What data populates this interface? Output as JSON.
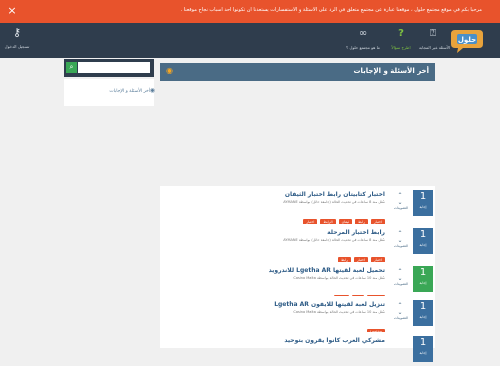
{
  "notice": {
    "text": "مرحبا بكم في موقع مجتمع حلول ، موقعنا عبارة عن مجتمع متعلق في الرد على الاسئلة و الاستفسارات يستعدنا ان تكونوا احد اسباب نجاح موقعنا .",
    "close": "×"
  },
  "header": {
    "login_label": "تسجيل الدخول",
    "login_icon": "key-icon",
    "logo_text": "حلول",
    "nav": [
      {
        "label": "الأسئلة غير المجابة",
        "icon": "question-circle-icon",
        "glyph": "⍰"
      },
      {
        "label": "اطرح سؤالاً",
        "icon": "question-mark-icon",
        "glyph": "?"
      },
      {
        "label": "ما هو مجتمع حلول ؟",
        "icon": "infinity-icon",
        "glyph": "∞"
      }
    ]
  },
  "sidebar": {
    "search_placeholder": "",
    "feed_label": "أخر الأسئلة و الإجابات"
  },
  "main": {
    "title": "أخر الأسئلة و الإجابات",
    "questions": [
      {
        "title": "اختبار كتابيتان رابط اختبار الثيفان",
        "votes": "1",
        "votes_label": "إجابة",
        "answers_label": "التصويتات",
        "meta": "سُئل منذ 8 ساعات في تحديث الحالة (جامعة حائل) بواسطة AYMANE",
        "tags": [
          "اختبار",
          "رابط",
          "ثيفان",
          "الرابط",
          "اختبار"
        ],
        "solved": false
      },
      {
        "title": "رابط اختبار المرحلة",
        "votes": "1",
        "votes_label": "إجابة",
        "answers_label": "التصويتات",
        "meta": "سُئل منذ 8 ساعات في تحديث الحالة (جامعة حائل) بواسطة AYMANE",
        "tags": [
          "اختبار",
          "اختبار",
          "رابط"
        ],
        "solved": false
      },
      {
        "title": "تحميل لعبة لقيتها Lgetha AR للاندرويد",
        "votes": "1",
        "votes_label": "إجابة",
        "answers_label": "التصويتات",
        "meta": "سُئل منذ 10 ساعات في تحديث الحالة بواسطة Casino Malta",
        "tags": [
          "Lgetha",
          "لعبة",
          "تحميل"
        ],
        "solved": true
      },
      {
        "title": "تنزيل لعبة لقيتها للايفون Lgetha AR",
        "votes": "1",
        "votes_label": "إجابة",
        "answers_label": "التصويتات",
        "meta": "سُئل منذ 10 ساعات في تحديث الحالة بواسطة Casino Malta",
        "tags": [
          "Lgetha"
        ],
        "solved": false
      },
      {
        "title": "مشركي العرب كانوا يقرون بتوحيد",
        "votes": "1",
        "votes_label": "إجابة",
        "answers_label": "التصويتات",
        "meta": "",
        "tags": [],
        "solved": false
      }
    ]
  },
  "colors": {
    "accent": "#e8532c",
    "header": "#2f3d4d",
    "title_bar": "#4a6b85",
    "vote": "#3b6f9f",
    "solved": "#3aa756",
    "ask": "#7fc241"
  }
}
